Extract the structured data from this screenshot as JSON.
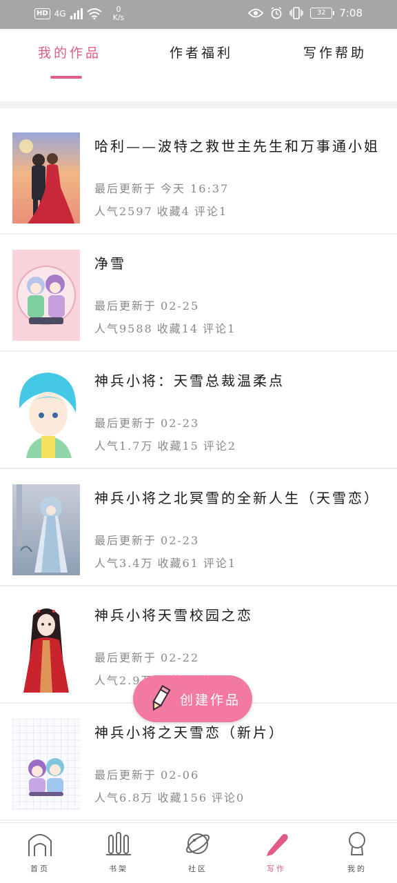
{
  "status_bar": {
    "hd": "HD",
    "network": "4G",
    "speed_value": "0",
    "speed_unit": "K/s",
    "battery": "32",
    "time": "7:08"
  },
  "tabs": [
    {
      "label": "我的作品",
      "active": true
    },
    {
      "label": "作者福利",
      "active": false
    },
    {
      "label": "写作帮助",
      "active": false
    }
  ],
  "works": [
    {
      "title": "哈利——波特之救世主先生和万事通小姐",
      "updated_label": "最后更新于",
      "updated": "今天 16:37",
      "popularity": "人气2597",
      "favorites": "收藏4",
      "comments": "评论1",
      "cover_icon": "couple-sunset-cover"
    },
    {
      "title": "净雪",
      "updated_label": "最后更新于",
      "updated": "02-25",
      "popularity": "人气9588",
      "favorites": "收藏14",
      "comments": "评论1",
      "cover_icon": "anime-duo-cover"
    },
    {
      "title": "神兵小将：天雪总裁温柔点",
      "updated_label": "最后更新于",
      "updated": "02-23",
      "popularity": "人气1.7万",
      "favorites": "收藏15",
      "comments": "评论2",
      "cover_icon": "blue-hair-boy-cover"
    },
    {
      "title": "神兵小将之北冥雪的全新人生（天雪恋）",
      "updated_label": "最后更新于",
      "updated": "02-23",
      "popularity": "人气3.4万",
      "favorites": "收藏61",
      "comments": "评论1",
      "cover_icon": "hanfu-girl-cover"
    },
    {
      "title": "神兵小将天雪校园之恋",
      "updated_label": "最后更新于",
      "updated": "02-22",
      "popularity": "人气2.9万",
      "favorites": "收藏",
      "comments": "评论",
      "cover_icon": "red-robe-girl-cover"
    },
    {
      "title": "神兵小将之天雪恋（新片）",
      "updated_label": "最后更新于",
      "updated": "02-06",
      "popularity": "人气6.8万",
      "favorites": "收藏156",
      "comments": "评论0",
      "cover_icon": "chibi-duo-cover"
    }
  ],
  "fab": {
    "label": "创建作品",
    "icon": "pencil-icon"
  },
  "bottom_nav": [
    {
      "label": "首页",
      "icon": "home-icon",
      "active": false
    },
    {
      "label": "书架",
      "icon": "bookshelf-icon",
      "active": false
    },
    {
      "label": "社区",
      "icon": "planet-icon",
      "active": false
    },
    {
      "label": "写作",
      "icon": "pencil-icon",
      "active": true
    },
    {
      "label": "我的",
      "icon": "profile-icon",
      "active": false
    }
  ],
  "colors": {
    "accent": "#e05c86",
    "fab": "#f27aa1",
    "status_bar": "#a6a6a6"
  }
}
